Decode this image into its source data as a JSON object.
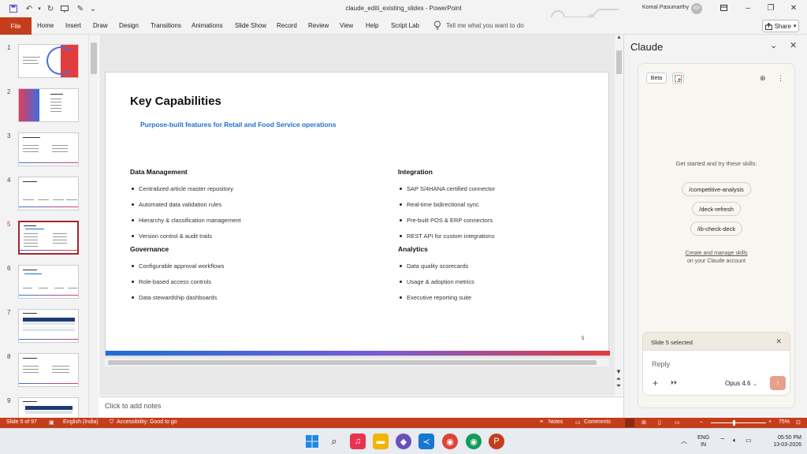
{
  "window": {
    "doc_title": "claude_editi_existing_slides  -  PowerPoint",
    "user_name": "Komal Pasumarthy",
    "user_initials": "KP"
  },
  "ribbon": {
    "file": "File",
    "tabs": [
      "Home",
      "Insert",
      "Draw",
      "Design",
      "Transitions",
      "Animations",
      "Slide Show",
      "Record",
      "Review",
      "View",
      "Help",
      "Script Lab"
    ],
    "tell_me": "Tell me what you want to do",
    "share": "Share"
  },
  "thumbnails": {
    "numbers": [
      "1",
      "2",
      "3",
      "4",
      "5",
      "6",
      "7",
      "8",
      "9"
    ],
    "active": "5"
  },
  "slide": {
    "title": "Key Capabilities",
    "subtitle": "Purpose-built features for Retail and Food Service operations",
    "sections": [
      {
        "heading": "Data Management",
        "items": [
          "Centralized article master repository",
          "Automated data validation rules",
          "Hierarchy & classification management",
          "Version control & audit trails"
        ]
      },
      {
        "heading": "Integration",
        "items": [
          "SAP S/4HANA certified connector",
          "Real-time bidirectional sync",
          "Pre-built POS & ERP connectors",
          "REST API for custom integrations"
        ]
      },
      {
        "heading": "Governance",
        "items": [
          "Configurable approval workflows",
          "Role-based access controls",
          "Data stewardship dashboards"
        ]
      },
      {
        "heading": "Analytics",
        "items": [
          "Data quality scorecards",
          "Usage & adoption metrics",
          "Executive reporting suite"
        ]
      }
    ],
    "page_number": "5",
    "accent_gradient": [
      "#1a6fd6",
      "#7b5ad6",
      "#e23c3c"
    ]
  },
  "notes_placeholder": "Click to add notes",
  "claude_pane": {
    "title": "Claude",
    "beta": "Beta",
    "get_started": "Get started and try these skills:",
    "skills": [
      "/competitive-analysis",
      "/deck-refresh",
      "/ib-check-deck"
    ],
    "manage_link": "Create and manage skills",
    "manage_suffix": "on your Claude account",
    "selection": "Slide 5 selected",
    "reply_placeholder": "Reply",
    "model": "Opus 4.6"
  },
  "status_bar": {
    "slide_info": "Slide 5 of 97",
    "language": "English (India)",
    "accessibility": "Accessibility: Good to go",
    "notes": "Notes",
    "comments": "Comments",
    "zoom": "75%"
  },
  "taskbar": {
    "lang_line1": "ENG",
    "lang_line2": "IN",
    "time": "05:50 PM",
    "date": "13-03-2026"
  },
  "colors": {
    "accent": "#c43e1c",
    "subtitle_blue": "#1a6fd6",
    "send_button": "#e8a08a"
  }
}
